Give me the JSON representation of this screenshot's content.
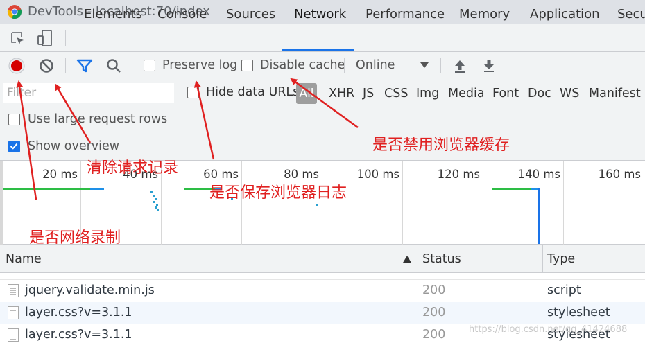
{
  "window": {
    "title": "DevTools - localhost:70/index"
  },
  "tabs": [
    "Elements",
    "Console",
    "Sources",
    "Network",
    "Performance",
    "Memory",
    "Application",
    "Secu"
  ],
  "toolbar": {
    "preserve_log": "Preserve log",
    "disable_cache": "Disable cache",
    "throttle": "Online"
  },
  "filter": {
    "placeholder": "Filter",
    "hide_data_urls": "Hide data URLs",
    "types": [
      "All",
      "XHR",
      "JS",
      "CSS",
      "Img",
      "Media",
      "Font",
      "Doc",
      "WS",
      "Manifest"
    ]
  },
  "options": {
    "large_rows": "Use large request rows",
    "show_overview": "Show overview"
  },
  "overview": {
    "ticks": [
      "20 ms",
      "40 ms",
      "60 ms",
      "80 ms",
      "100 ms",
      "120 ms",
      "140 ms",
      "160 ms"
    ]
  },
  "table": {
    "columns": [
      "Name",
      "Status",
      "Type"
    ],
    "rows": [
      {
        "name": "jquery.validate.min.js",
        "status": "200",
        "type": "script"
      },
      {
        "name": "layer.css?v=3.1.1",
        "status": "200",
        "type": "stylesheet"
      },
      {
        "name": "layer.css?v=3.1.1",
        "status": "200",
        "type": "stylesheet"
      }
    ]
  },
  "annotations": {
    "disable_cache": "是否禁用浏览器缓存",
    "clear": "清除请求记录",
    "preserve": "是否保存浏览器日志",
    "record": "是否网络录制"
  },
  "watermark": "https://blog.csdn.net/qq_41424688",
  "colors": {
    "record": "#d50000",
    "accent": "#1a73e8",
    "annotation": "#e02020"
  }
}
